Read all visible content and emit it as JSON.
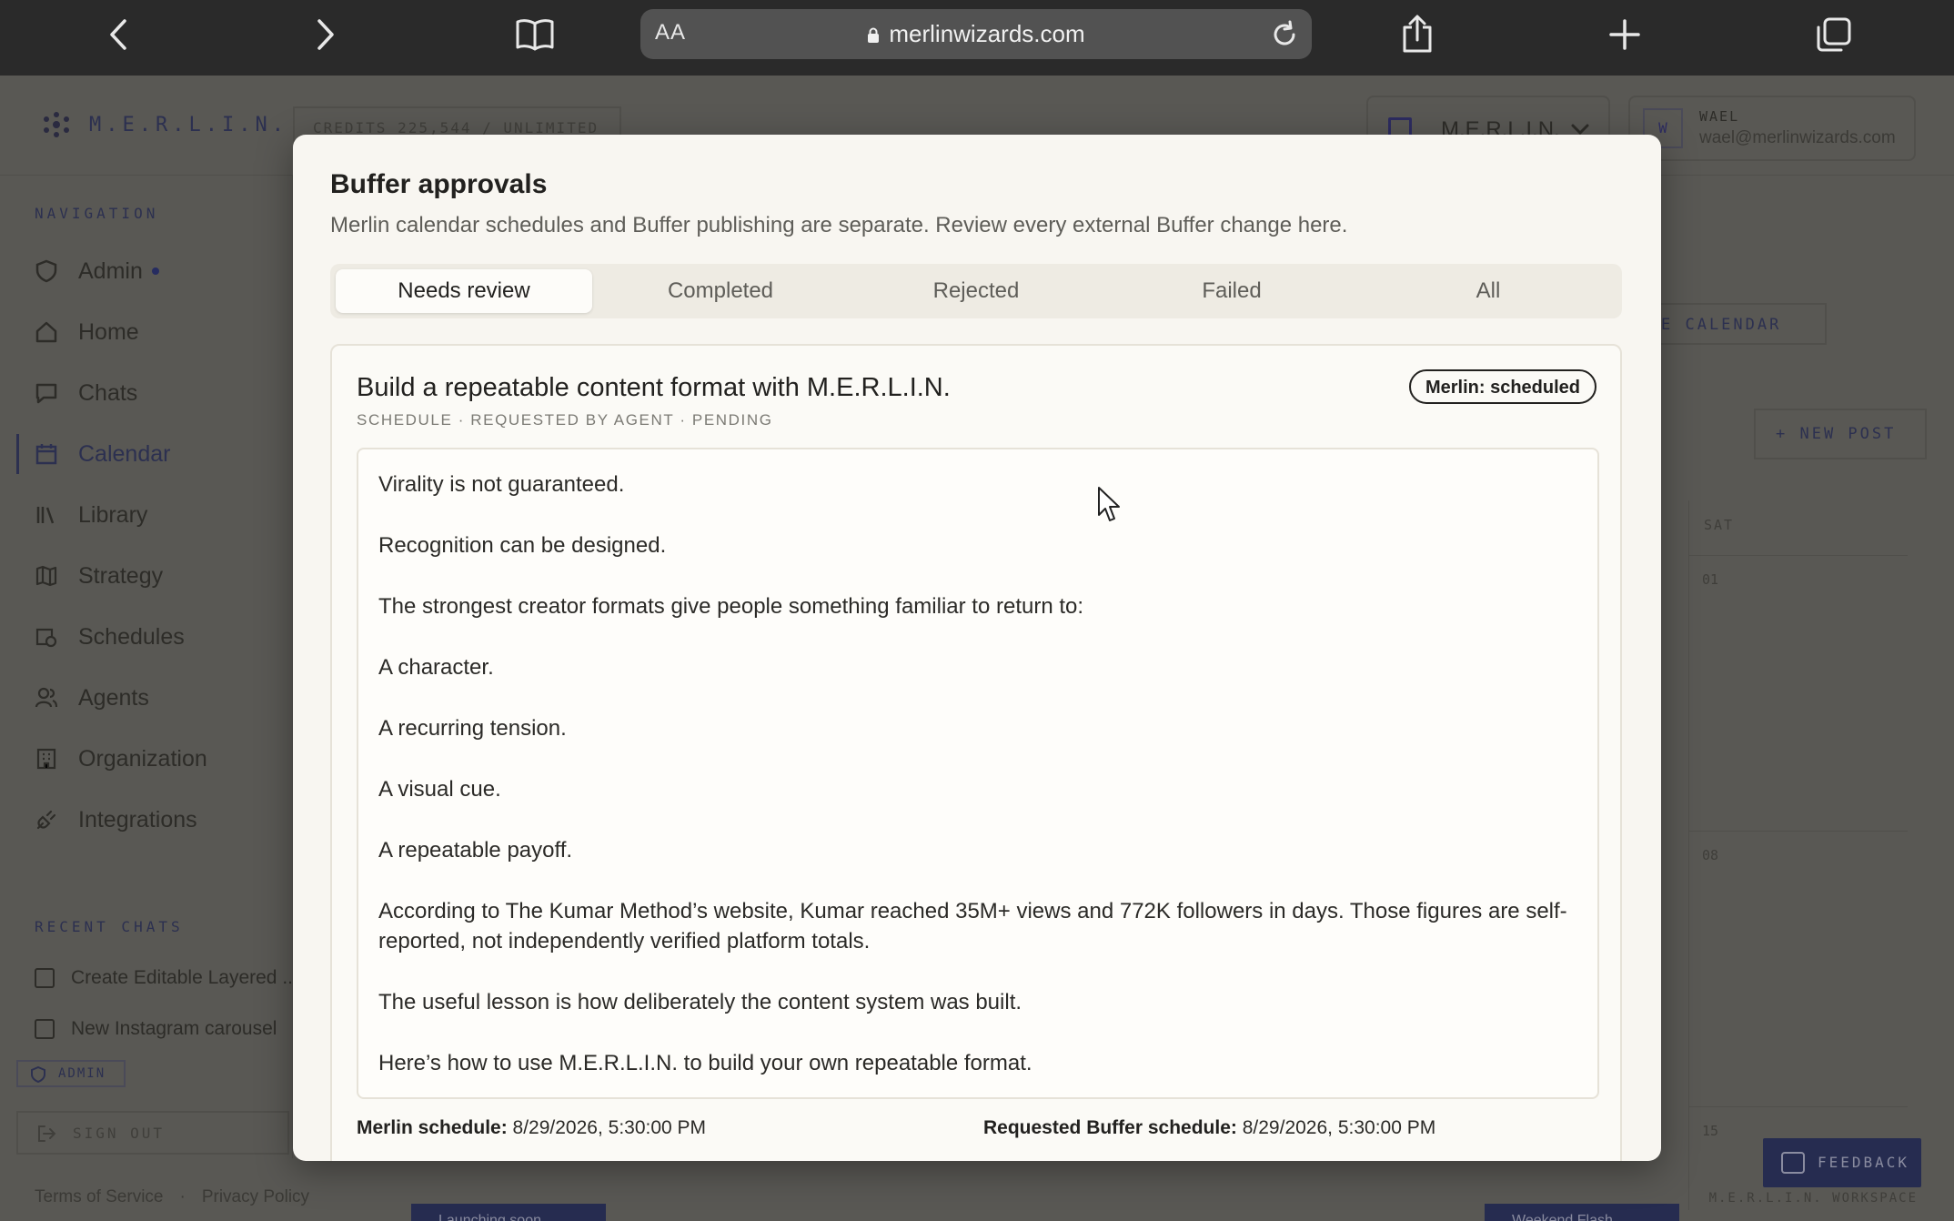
{
  "browser": {
    "aa_label": "AA",
    "url": "merlinwizards.com"
  },
  "app": {
    "logo_text": "M.E.R.L.I.N.",
    "credits": "CREDITS 225,544 / UNLIMITED",
    "org_name": "M.E.R.L.I.N.",
    "user": {
      "initial": "W",
      "name": "WAEL",
      "email": "wael@merlinwizards.com"
    },
    "nav_heading": "NAVIGATION",
    "nav_items": [
      {
        "label": "Admin",
        "icon": "shield-icon"
      },
      {
        "label": "Home",
        "icon": "home-icon"
      },
      {
        "label": "Chats",
        "icon": "chat-icon"
      },
      {
        "label": "Calendar",
        "icon": "calendar-icon"
      },
      {
        "label": "Library",
        "icon": "library-icon"
      },
      {
        "label": "Strategy",
        "icon": "map-icon"
      },
      {
        "label": "Schedules",
        "icon": "schedule-icon"
      },
      {
        "label": "Agents",
        "icon": "agents-icon"
      },
      {
        "label": "Organization",
        "icon": "building-icon"
      },
      {
        "label": "Integrations",
        "icon": "plug-icon"
      }
    ],
    "recent_heading": "RECENT CHATS",
    "recent_chats": [
      "Create Editable Layered ...",
      "New Instagram carousel"
    ],
    "admin_chip": "ADMIN",
    "sign_out": "SIGN OUT",
    "footer": {
      "terms": "Terms of Service",
      "separator": "·",
      "privacy": "Privacy Policy",
      "workspace": "M.E.R.L.I.N. WORKSPACE"
    },
    "calendar_button": "E CALENDAR",
    "new_post": "+ NEW POST",
    "sat_label": "SAT",
    "days": [
      "01",
      "08",
      "15"
    ],
    "feedback": "FEEDBACK",
    "events": [
      "Launching soon",
      "Weekend Flash"
    ]
  },
  "modal": {
    "title": "Buffer approvals",
    "subtitle": "Merlin calendar schedules and Buffer publishing are separate. Review every external Buffer change here.",
    "tabs": [
      "Needs review",
      "Completed",
      "Rejected",
      "Failed",
      "All"
    ],
    "selected_tab": "Needs review",
    "card": {
      "title": "Build a repeatable content format with M.E.R.L.I.N.",
      "meta": "SCHEDULE · REQUESTED BY AGENT · PENDING",
      "status": "Merlin: scheduled",
      "body": [
        "Virality is not guaranteed.",
        "Recognition can be designed.",
        "The strongest creator formats give people something familiar to return to:",
        "A character.",
        "A recurring tension.",
        "A visual cue.",
        "A repeatable payoff.",
        "According to The Kumar Method’s website, Kumar reached 35M+ views and 772K followers in days. Those figures are self-reported, not independently verified platform totals.",
        "The useful lesson is how deliberately the content system was built.",
        "Here’s how to use M.E.R.L.I.N. to build your own repeatable format."
      ],
      "merlin_schedule_label": "Merlin schedule:",
      "merlin_schedule_value": "8/29/2026, 5:30:00 PM",
      "buffer_schedule_label": "Requested Buffer schedule:",
      "buffer_schedule_value": "8/29/2026, 5:30:00 PM"
    }
  },
  "colors": {
    "accent": "#2c3050",
    "modal_bg": "#f8f6f1",
    "tab_track": "#eeebe3"
  }
}
